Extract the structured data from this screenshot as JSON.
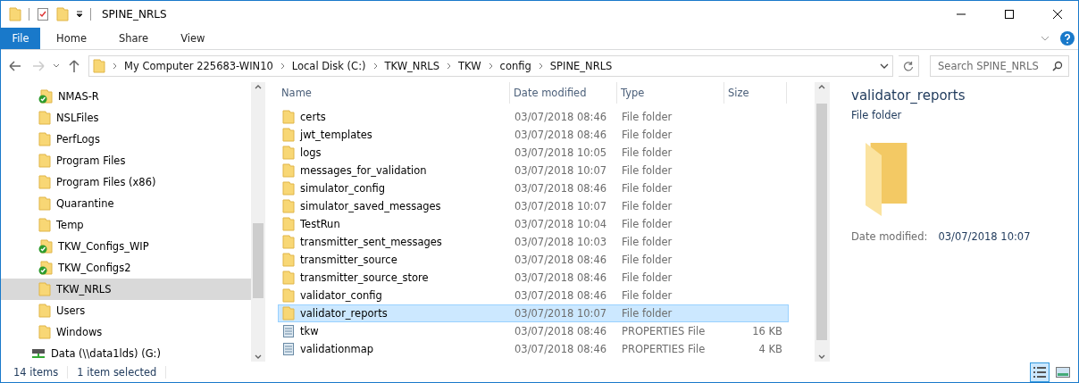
{
  "window": {
    "title": "SPINE_NRLS"
  },
  "ribbon_tabs": [
    {
      "label": "File",
      "selected": true
    },
    {
      "label": "Home",
      "selected": false
    },
    {
      "label": "Share",
      "selected": false
    },
    {
      "label": "View",
      "selected": false
    }
  ],
  "breadcrumb": [
    "My Computer 225683-WIN10",
    "Local Disk (C:)",
    "TKW_NRLS",
    "TKW",
    "config",
    "SPINE_NRLS"
  ],
  "search": {
    "placeholder": "Search SPINE_NRLS"
  },
  "sidebar": {
    "items": [
      {
        "label": "NMAS-R",
        "kind": "synced",
        "selected": false
      },
      {
        "label": "NSLFiles",
        "kind": "folder",
        "selected": false
      },
      {
        "label": "PerfLogs",
        "kind": "folder",
        "selected": false
      },
      {
        "label": "Program Files",
        "kind": "folder",
        "selected": false
      },
      {
        "label": "Program Files (x86)",
        "kind": "folder",
        "selected": false
      },
      {
        "label": "Quarantine",
        "kind": "folder",
        "selected": false
      },
      {
        "label": "Temp",
        "kind": "folder",
        "selected": false
      },
      {
        "label": "TKW_Configs_WIP",
        "kind": "synced",
        "selected": false
      },
      {
        "label": "TKW_Configs2",
        "kind": "synced",
        "selected": false
      },
      {
        "label": "TKW_NRLS",
        "kind": "folder",
        "selected": true
      },
      {
        "label": "Users",
        "kind": "folder",
        "selected": false
      },
      {
        "label": "Windows",
        "kind": "folder",
        "selected": false
      },
      {
        "label": "Data (\\\\data1lds) (G:)",
        "kind": "drive",
        "selected": false
      }
    ]
  },
  "table": {
    "columns": [
      "Name",
      "Date modified",
      "Type",
      "Size"
    ],
    "rows": [
      {
        "name": "certs",
        "date": "03/07/2018 08:46",
        "type": "File folder",
        "kind": "folder",
        "selected": false
      },
      {
        "name": "jwt_templates",
        "date": "03/07/2018 08:46",
        "type": "File folder",
        "kind": "folder",
        "selected": false
      },
      {
        "name": "logs",
        "date": "03/07/2018 10:05",
        "type": "File folder",
        "kind": "folder",
        "selected": false
      },
      {
        "name": "messages_for_validation",
        "date": "03/07/2018 10:07",
        "type": "File folder",
        "kind": "folder",
        "selected": false
      },
      {
        "name": "simulator_config",
        "date": "03/07/2018 08:46",
        "type": "File folder",
        "kind": "folder",
        "selected": false
      },
      {
        "name": "simulator_saved_messages",
        "date": "03/07/2018 10:07",
        "type": "File folder",
        "kind": "folder",
        "selected": false
      },
      {
        "name": "TestRun",
        "date": "03/07/2018 10:04",
        "type": "File folder",
        "kind": "folder",
        "selected": false
      },
      {
        "name": "transmitter_sent_messages",
        "date": "03/07/2018 10:03",
        "type": "File folder",
        "kind": "folder",
        "selected": false
      },
      {
        "name": "transmitter_source",
        "date": "03/07/2018 08:46",
        "type": "File folder",
        "kind": "folder",
        "selected": false
      },
      {
        "name": "transmitter_source_store",
        "date": "03/07/2018 08:46",
        "type": "File folder",
        "kind": "folder",
        "selected": false
      },
      {
        "name": "validator_config",
        "date": "03/07/2018 08:46",
        "type": "File folder",
        "kind": "folder",
        "selected": false
      },
      {
        "name": "validator_reports",
        "date": "03/07/2018 10:07",
        "type": "File folder",
        "kind": "folder",
        "selected": true
      },
      {
        "name": "tkw",
        "date": "03/07/2018 08:46",
        "type": "PROPERTIES File",
        "size": "16 KB",
        "kind": "file",
        "selected": false
      },
      {
        "name": "validationmap",
        "date": "03/07/2018 08:46",
        "type": "PROPERTIES File",
        "size": "4 KB",
        "kind": "file",
        "selected": false
      }
    ]
  },
  "preview": {
    "title": "validator_reports",
    "subtitle": "File folder",
    "label": "Date modified:",
    "value": "03/07/2018 10:07"
  },
  "status_bar": {
    "count": "14 items",
    "selection": "1 item selected"
  }
}
